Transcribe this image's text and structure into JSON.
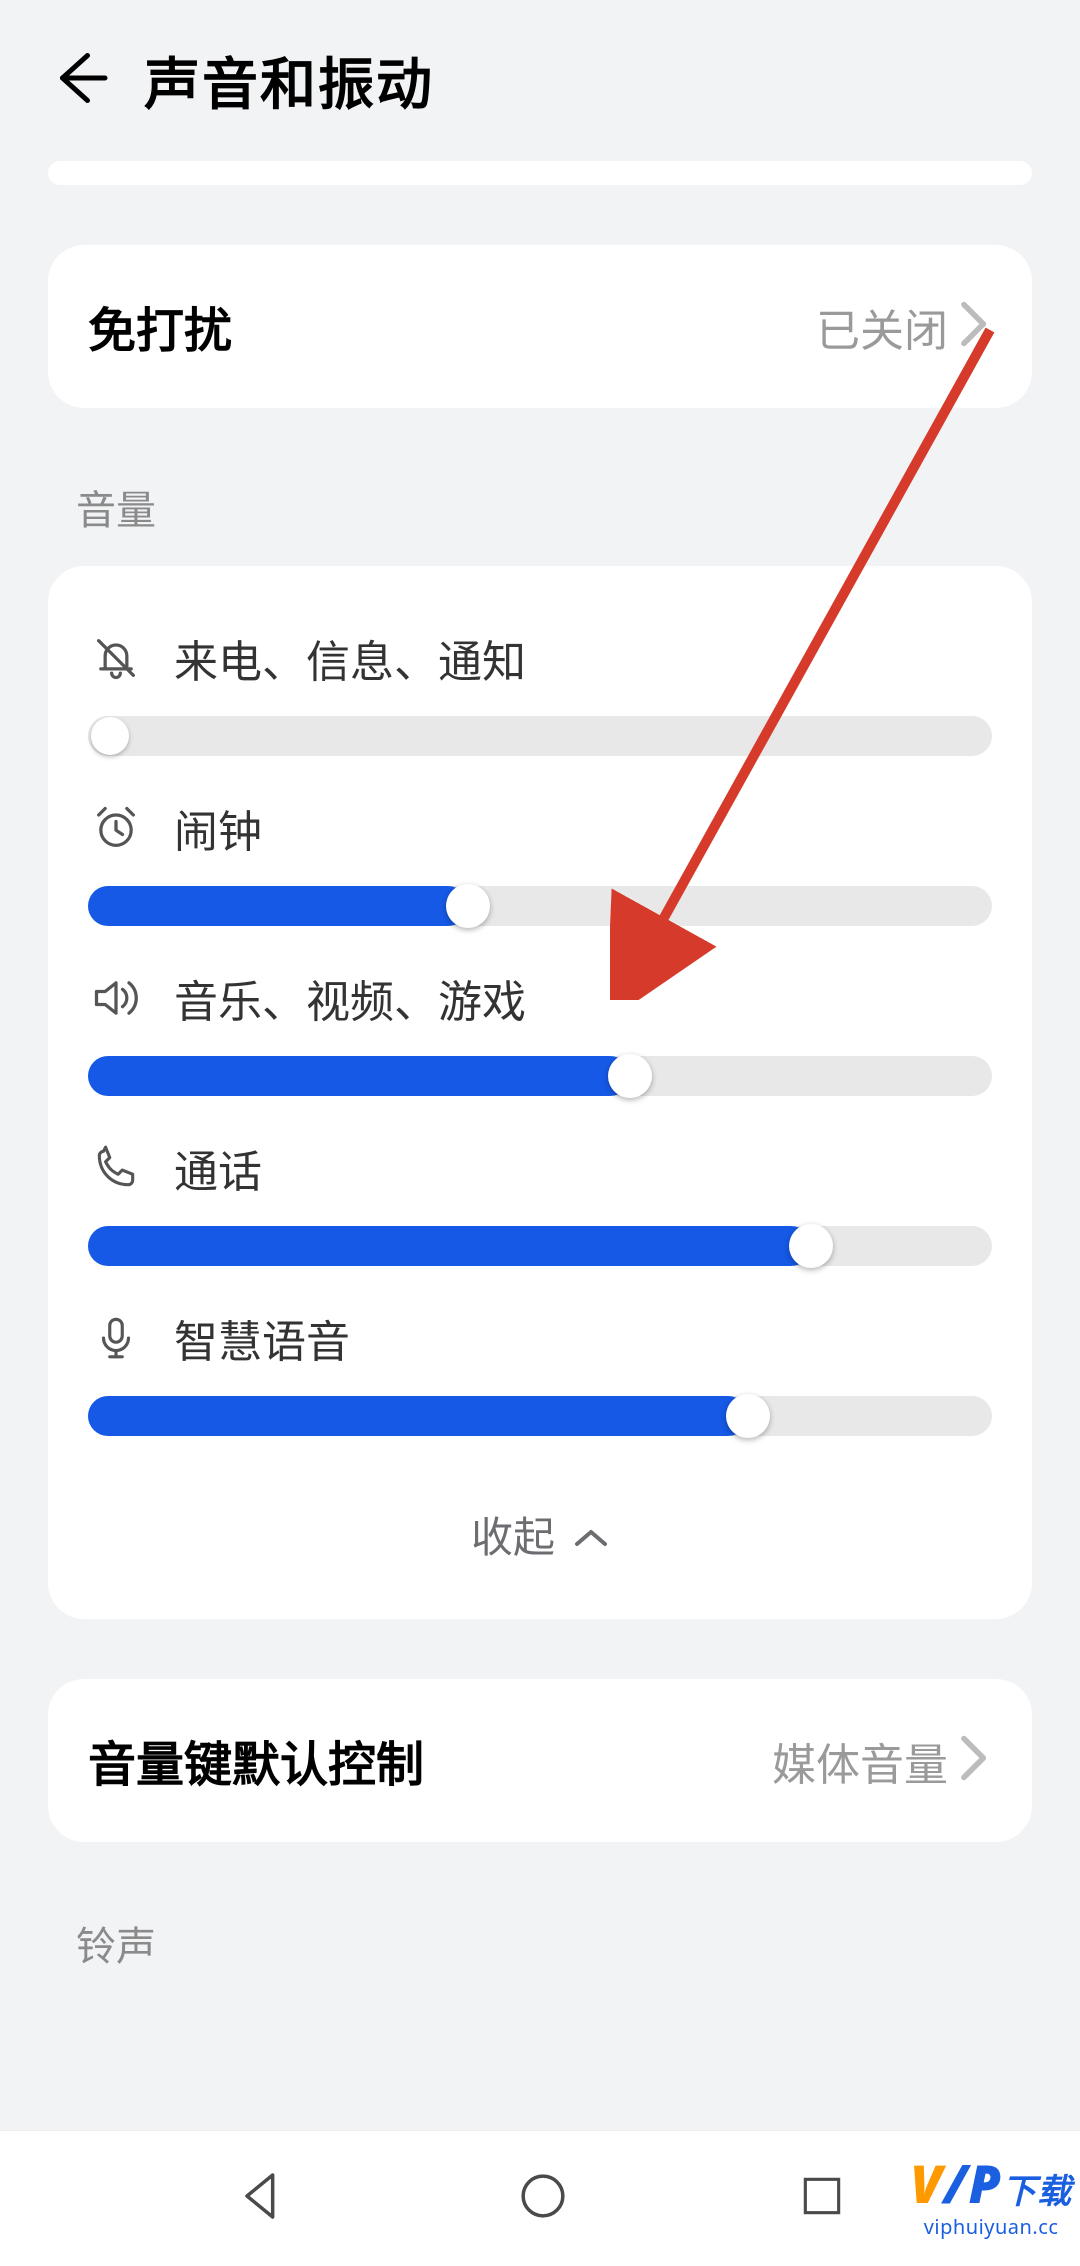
{
  "header": {
    "title": "声音和振动"
  },
  "dnd_row": {
    "label": "免打扰",
    "value": "已关闭"
  },
  "volume_section": "音量",
  "sliders": {
    "ring": {
      "label": "来电、信息、通知",
      "percent": 0
    },
    "alarm": {
      "label": "闹钟",
      "percent": 42
    },
    "media": {
      "label": "音乐、视频、游戏",
      "percent": 60
    },
    "call": {
      "label": "通话",
      "percent": 80
    },
    "voice": {
      "label": "智慧语音",
      "percent": 73
    }
  },
  "collapse_label": "收起",
  "volkey_row": {
    "label": "音量键默认控制",
    "value": "媒体音量"
  },
  "ringtone_section": "铃声",
  "watermark": {
    "brand_left": "V",
    "brand_mid": "/P",
    "brand_right": "下载",
    "domain": "viphuiyuan.cc"
  },
  "colors": {
    "accent": "#1659e6",
    "arrow": "#d63a2a"
  }
}
